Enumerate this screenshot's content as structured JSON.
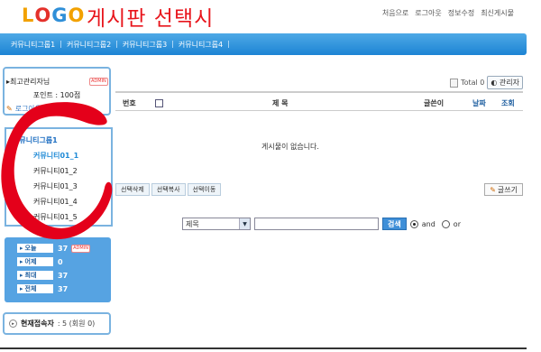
{
  "header": {
    "logo_letters": [
      {
        "ch": "L",
        "color": "#f2a100"
      },
      {
        "ch": "O",
        "color": "#e4312b"
      },
      {
        "ch": "G",
        "color": "#2f8fd8"
      },
      {
        "ch": "O",
        "color": "#f2a100"
      }
    ],
    "page_title": "게시판 선택시",
    "links": [
      "처음으로",
      "로그아웃",
      "정보수정",
      "최신게시물"
    ]
  },
  "nav": {
    "groups": [
      "커뮤니티그룹1",
      "커뮤니티그룹2",
      "커뮤니티그룹3",
      "커뮤니티그룹4"
    ],
    "separator": "|"
  },
  "user": {
    "name": "최고관리자님",
    "badge": "ADMIN",
    "points": "포인트 : 100점",
    "logout": "로그아웃"
  },
  "community": {
    "group": "커뮤니티그룹1",
    "items": [
      "커뮤니티01_1",
      "커뮤니티01_2",
      "커뮤니티01_3",
      "커뮤니티01_4",
      "커뮤니티01_5"
    ]
  },
  "stats": [
    {
      "label": "오늘",
      "value": "37",
      "badge": "ADMIN"
    },
    {
      "label": "어제",
      "value": "0"
    },
    {
      "label": "최대",
      "value": "37"
    },
    {
      "label": "전체",
      "value": "37"
    }
  ],
  "online": {
    "label": "현재접속자",
    "value": ": 5 (회원 0)"
  },
  "board": {
    "total_label": "Total 0",
    "admin_button": "관리자",
    "columns": {
      "num": "번호",
      "subject": "제  목",
      "author": "글쓴이",
      "date": "날짜",
      "views": "조회"
    },
    "empty_message": "게시물이 없습니다.",
    "actions": [
      "선택삭제",
      "선택복사",
      "선택이동"
    ],
    "write_button": "글쓰기"
  },
  "search": {
    "field": "제목",
    "button": "검색",
    "and_label": "and",
    "or_label": "or",
    "selected_op": "and"
  },
  "colors": {
    "accent": "#2f8fd8",
    "annotation": "#e4001a"
  }
}
